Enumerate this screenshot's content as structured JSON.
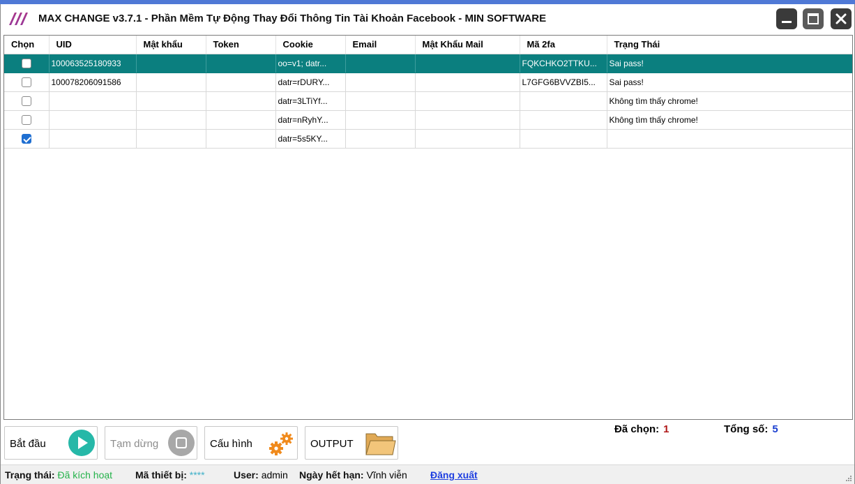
{
  "window": {
    "title": "MAX CHANGE v3.7.1 - Phần Mềm Tự Động Thay Đổi Thông Tin Tài Khoản Facebook - MIN SOFTWARE",
    "logo": "MIN logo (three slanted strokes, purple-red gradient)",
    "controls": [
      "minimize-icon",
      "maximize-icon",
      "close-icon"
    ]
  },
  "table": {
    "columns": [
      "Chọn",
      "UID",
      "Mật khẩu",
      "Token",
      "Cookie",
      "Email",
      "Mật Khẩu Mail",
      "Mã 2fa",
      "Trạng Thái"
    ],
    "rows": [
      {
        "checked": false,
        "selected": true,
        "uid": "100063525180933",
        "password": "",
        "token": "",
        "cookie": "oo=v1; datr...",
        "email": "",
        "mail_password": "",
        "twofa": "FQKCHKO2TTKU...",
        "status": "Sai pass!"
      },
      {
        "checked": false,
        "selected": false,
        "uid": "100078206091586",
        "password": "",
        "token": "",
        "cookie": "datr=rDURY...",
        "email": "",
        "mail_password": "",
        "twofa": "L7GFG6BVVZBI5...",
        "status": "Sai pass!"
      },
      {
        "checked": false,
        "selected": false,
        "uid": "",
        "password": "",
        "token": "",
        "cookie": "datr=3LTiYf...",
        "email": "",
        "mail_password": "",
        "twofa": "",
        "status": "Không tìm thấy chrome!"
      },
      {
        "checked": false,
        "selected": false,
        "uid": "",
        "password": "",
        "token": "",
        "cookie": "datr=nRyhY...",
        "email": "",
        "mail_password": "",
        "twofa": "",
        "status": "Không tìm thấy chrome!"
      },
      {
        "checked": true,
        "selected": false,
        "uid": "",
        "password": "",
        "token": "",
        "cookie": "datr=5s5KY...",
        "email": "",
        "mail_password": "",
        "twofa": "",
        "status": ""
      }
    ]
  },
  "actions": {
    "start_label": "Bắt đầu",
    "pause_label": "Tạm dừng",
    "config_label": "Cấu hình",
    "output_label": "OUTPUT"
  },
  "counts": {
    "selected_label": "Đã chọn:",
    "selected_value": "1",
    "total_label": "Tổng số:",
    "total_value": "5"
  },
  "statusbar": {
    "status_label": "Trạng thái:",
    "status_value": "Đã kích hoạt",
    "device_label": "Mã thiết bị:",
    "device_value": "****",
    "user_label": "User:",
    "user_value": "admin",
    "expiry_label": "Ngày hết hạn:",
    "expiry_value": "Vĩnh viễn",
    "logout_label": "Đăng xuất"
  },
  "colors": {
    "title_accent": "#4f79d6",
    "selected_row": "#0b7f7f",
    "play_icon": "#26b8a8",
    "gear_icon": "#f08a1c",
    "folder_icon": "#f2c57a",
    "active_status": "#24b24a",
    "logout_link": "#1f3fe0"
  }
}
